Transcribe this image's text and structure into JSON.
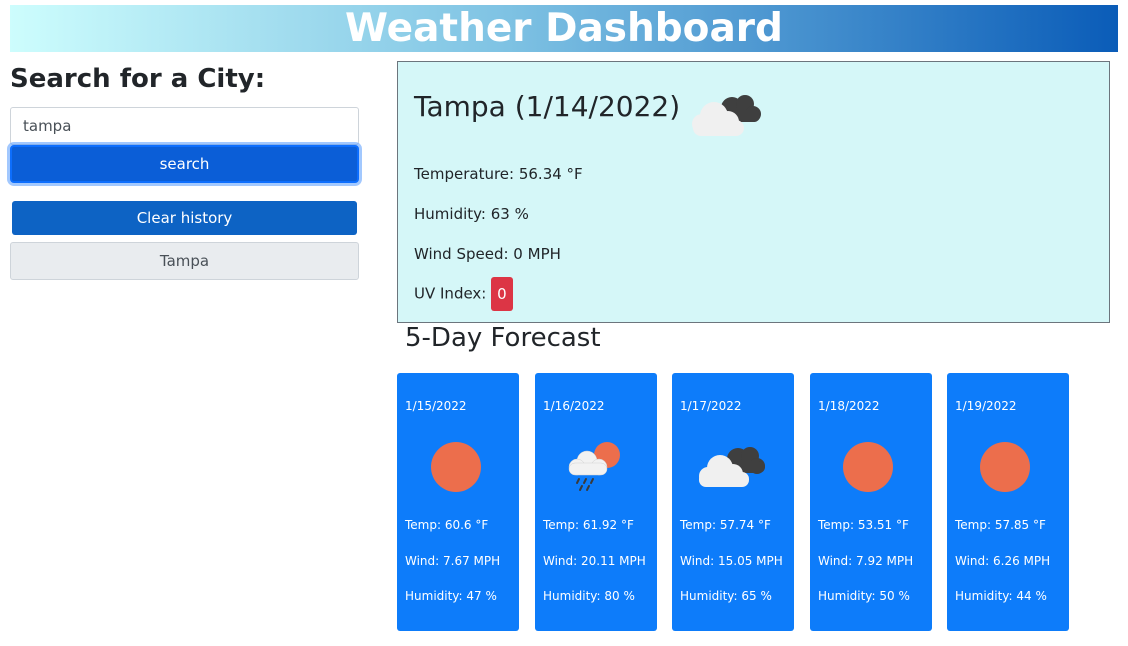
{
  "header": {
    "title": "Weather Dashboard"
  },
  "search": {
    "title": "Search for a City:",
    "input_value": "tampa",
    "button_label": "search",
    "clear_label": "Clear history",
    "history": [
      "Tampa"
    ]
  },
  "current": {
    "city_date": "Tampa (1/14/2022)",
    "icon": "clouds-icon",
    "temperature": "Temperature: 56.34 °F",
    "humidity": "Humidity: 63 %",
    "wind": "Wind Speed: 0 MPH",
    "uv_label": "UV Index:",
    "uv_value": "0",
    "uv_color": "#dc3545"
  },
  "forecast": {
    "title": "5-Day Forecast",
    "days": [
      {
        "date": "1/15/2022",
        "icon": "sun-icon",
        "temp": "Temp: 60.6 °F",
        "wind": "Wind: 7.67 MPH",
        "humidity": "Humidity: 47 %"
      },
      {
        "date": "1/16/2022",
        "icon": "rain-sun-icon",
        "temp": "Temp: 61.92 °F",
        "wind": "Wind: 20.11 MPH",
        "humidity": "Humidity: 80 %"
      },
      {
        "date": "1/17/2022",
        "icon": "clouds-icon",
        "temp": "Temp: 57.74 °F",
        "wind": "Wind: 15.05 MPH",
        "humidity": "Humidity: 65 %"
      },
      {
        "date": "1/18/2022",
        "icon": "sun-icon",
        "temp": "Temp: 53.51 °F",
        "wind": "Wind: 7.92 MPH",
        "humidity": "Humidity: 50 %"
      },
      {
        "date": "1/19/2022",
        "icon": "sun-icon",
        "temp": "Temp: 57.85 °F",
        "wind": "Wind: 6.26 MPH",
        "humidity": "Humidity: 44 %"
      }
    ]
  },
  "colors": {
    "card": "#0d7cfa",
    "current_bg": "#d5f7f8",
    "sun": "#ec6e4c",
    "primary": "#0d6efd"
  }
}
